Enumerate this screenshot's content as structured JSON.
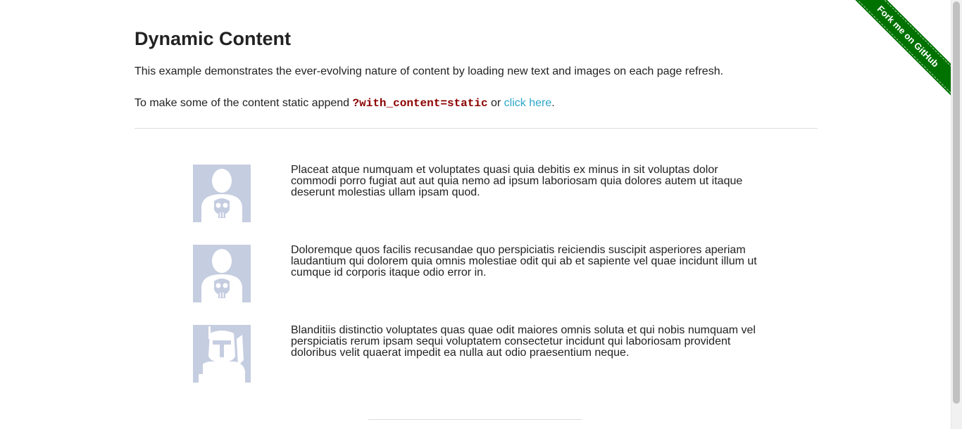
{
  "page": {
    "title": "Dynamic Content",
    "intro": "This example demonstrates the ever-evolving nature of content by loading new text and images on each page refresh.",
    "static_hint_prefix": "To make some of the content static append ",
    "static_param": "?with_content=static",
    "static_hint_middle": " or ",
    "click_here_label": "click here",
    "static_hint_suffix": "."
  },
  "rows": [
    {
      "avatar": "punisher-avatar-icon",
      "text": "Placeat atque numquam et voluptates quasi quia debitis ex minus in sit voluptas dolor commodi porro fugiat aut aut quia nemo ad ipsum laboriosam quia dolores autem ut itaque deserunt molestias ullam ipsam quod."
    },
    {
      "avatar": "punisher-avatar-icon",
      "text": "Doloremque quos facilis recusandae quo perspiciatis reiciendis suscipit asperiores aperiam laudantium qui dolorem quia omnis molestiae odit qui ab et sapiente vel quae incidunt illum ut cumque id corporis itaque odio error in."
    },
    {
      "avatar": "boba-fett-avatar-icon",
      "text": "Blanditiis distinctio voluptates quas quae odit maiores omnis soluta et qui nobis numquam vel perspiciatis rerum ipsam sequi voluptatem consectetur incidunt qui laboriosam provident doloribus velit quaerat impedit ea nulla aut odio praesentium neque."
    }
  ],
  "ribbon": {
    "label": "Fork me on GitHub"
  },
  "colors": {
    "link": "#2ba6cb",
    "code": "#8b0000",
    "ribbon": "#007200",
    "avatar_bg": "#c5cde0"
  }
}
